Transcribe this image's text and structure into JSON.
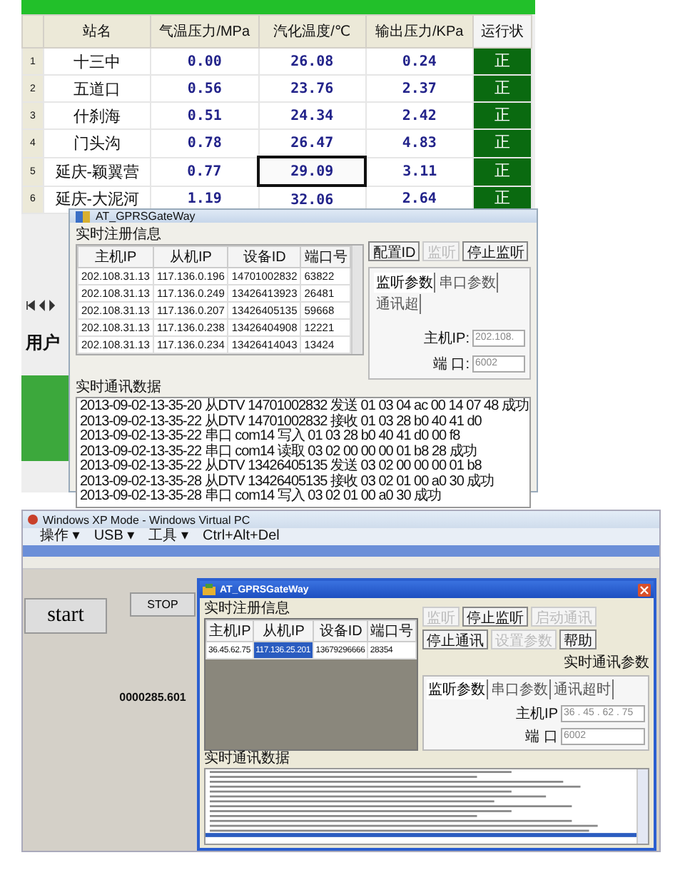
{
  "station_table": {
    "columns": [
      "站名",
      "气温压力/MPa",
      "汽化温度/℃",
      "输出压力/KPa",
      "运行状"
    ],
    "rows": [
      {
        "index": "1",
        "cells": [
          {
            "text": "十三中",
            "focused": false
          },
          {
            "text": "0.00",
            "focused": false
          },
          {
            "text": "26.08",
            "focused": false
          },
          {
            "text": "0.24",
            "focused": false
          },
          {
            "text": "正",
            "focused": false
          }
        ]
      },
      {
        "index": "2",
        "cells": [
          {
            "text": "五道口",
            "focused": false
          },
          {
            "text": "0.56",
            "focused": false
          },
          {
            "text": "23.76",
            "focused": false
          },
          {
            "text": "2.37",
            "focused": false
          },
          {
            "text": "正",
            "focused": false
          }
        ]
      },
      {
        "index": "3",
        "cells": [
          {
            "text": "什刹海",
            "focused": false
          },
          {
            "text": "0.51",
            "focused": false
          },
          {
            "text": "24.34",
            "focused": false
          },
          {
            "text": "2.42",
            "focused": false
          },
          {
            "text": "正",
            "focused": false
          }
        ]
      },
      {
        "index": "4",
        "cells": [
          {
            "text": "门头沟",
            "focused": false
          },
          {
            "text": "0.78",
            "focused": false
          },
          {
            "text": "26.47",
            "focused": false
          },
          {
            "text": "4.83",
            "focused": false
          },
          {
            "text": "正",
            "focused": false
          }
        ]
      },
      {
        "index": "5",
        "cells": [
          {
            "text": "延庆-颖翼营",
            "focused": false
          },
          {
            "text": "0.77",
            "focused": false
          },
          {
            "text": "29.09",
            "focused": true
          },
          {
            "text": "3.11",
            "focused": false
          },
          {
            "text": "正",
            "focused": false
          }
        ]
      },
      {
        "index": "6",
        "cells": [
          {
            "text": "延庆-大泥河",
            "focused": false
          },
          {
            "text": "1.19",
            "focused": false
          },
          {
            "text": "32.06",
            "focused": false
          },
          {
            "text": "2.64",
            "focused": false
          },
          {
            "text": "正",
            "focused": false
          }
        ]
      }
    ]
  },
  "sidebar": {
    "label": "用户"
  },
  "gateway_dialog": {
    "title": "AT_GPRSGateWay",
    "group_title": "实时注册信息",
    "registry": {
      "columns": [
        "主机IP",
        "从机IP",
        "设备ID",
        "端口号"
      ],
      "rows": [
        {
          "cells": [
            {
              "text": "202.108.31.13",
              "selected": false
            },
            {
              "text": "117.136.0.196",
              "selected": false
            },
            {
              "text": "14701002832",
              "selected": false
            },
            {
              "text": "63822",
              "selected": false
            }
          ]
        },
        {
          "cells": [
            {
              "text": "202.108.31.13",
              "selected": false
            },
            {
              "text": "117.136.0.249",
              "selected": false
            },
            {
              "text": "13426413923",
              "selected": false
            },
            {
              "text": "26481",
              "selected": false
            }
          ]
        },
        {
          "cells": [
            {
              "text": "202.108.31.13",
              "selected": false
            },
            {
              "text": "117.136.0.207",
              "selected": false
            },
            {
              "text": "13426405135",
              "selected": false
            },
            {
              "text": "59668",
              "selected": false
            }
          ]
        },
        {
          "cells": [
            {
              "text": "202.108.31.13",
              "selected": false
            },
            {
              "text": "117.136.0.238",
              "selected": false
            },
            {
              "text": "13426404908",
              "selected": false
            },
            {
              "text": "12221",
              "selected": false
            }
          ]
        },
        {
          "cells": [
            {
              "text": "202.108.31.13",
              "selected": false
            },
            {
              "text": "117.136.0.234",
              "selected": false
            },
            {
              "text": "13426414043",
              "selected": false
            },
            {
              "text": "13424",
              "selected": false
            }
          ]
        }
      ]
    },
    "buttons": [
      {
        "label": "配置ID",
        "disabled": false
      },
      {
        "label": "监听",
        "disabled": true
      },
      {
        "label": "停止监听",
        "disabled": false
      }
    ],
    "tabs": [
      {
        "label": "监听参数",
        "selected": true
      },
      {
        "label": "串口参数",
        "selected": false
      },
      {
        "label": "通讯超",
        "selected": false
      }
    ],
    "fields": [
      {
        "label": "主机IP:",
        "value": "202.108."
      },
      {
        "label": "端 口:",
        "value": "6002"
      }
    ],
    "log_title": "实时通讯数据",
    "log_lines": [
      "2013-09-02-13-35-20 从DTV 14701002832 发送 01 03 04 ac 00 14 07 48 成功",
      "2013-09-02-13-35-22 从DTV 14701002832 接收 01 03 28 b0 40 41 d0",
      "2013-09-02-13-35-22 串口 com14 写入 01 03 28 b0 40 41 d0 00 f8",
      "2013-09-02-13-35-22 串口 com14 读取 03 02 00 00 00 01 b8 28 成功",
      "2013-09-02-13-35-22 从DTV 13426405135 发送 03 02 00 00 00 01 b8",
      "2013-09-02-13-35-28 从DTV 13426405135 接收 03 02 01 00 a0 30 成功",
      "2013-09-02-13-35-28 串口 com14 写入 03 02 01 00 a0 30 成功"
    ]
  },
  "vpc_window": {
    "title": "Windows XP Mode - Windows Virtual PC",
    "menu": [
      "操作 ▾",
      "USB ▾",
      "工具 ▾",
      "Ctrl+Alt+Del"
    ],
    "start_button": "start",
    "stop_button": "STOP",
    "counter": "0000285.601",
    "dialog": {
      "title": "AT_GPRSGateWay",
      "group_title": "实时注册信息",
      "registry": {
        "columns": [
          "主机IP",
          "从机IP",
          "设备ID",
          "端口号"
        ],
        "rows": [
          {
            "cells": [
              {
                "text": "36.45.62.75",
                "selected": false
              },
              {
                "text": "117.136.25.201",
                "selected": true
              },
              {
                "text": "13679296666",
                "selected": false
              },
              {
                "text": "28354",
                "selected": false
              }
            ]
          }
        ]
      },
      "buttons": [
        {
          "label": "监听",
          "disabled": true
        },
        {
          "label": "停止监听",
          "disabled": false
        },
        {
          "label": "启动通讯",
          "disabled": true
        },
        {
          "label": "停止通讯",
          "disabled": false
        },
        {
          "label": "设置参数",
          "disabled": true
        },
        {
          "label": "帮助",
          "disabled": false
        }
      ],
      "side_label": "实时通讯参数",
      "tabs": [
        {
          "label": "监听参数",
          "selected": true
        },
        {
          "label": "串口参数",
          "selected": false
        },
        {
          "label": "通讯超时",
          "selected": false
        }
      ],
      "fields": [
        {
          "label": "主机IP",
          "value": "36 . 45 . 62 . 75"
        },
        {
          "label": "端 口",
          "value": "6002"
        }
      ],
      "log_title": "实时通讯数据"
    }
  }
}
